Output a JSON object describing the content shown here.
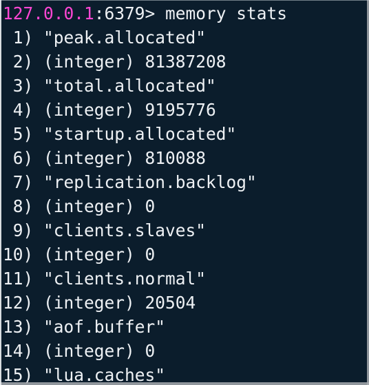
{
  "terminal": {
    "background_color": "#0b1d2c",
    "foreground_color": "#eef1f4",
    "accent_color": "#ff46d4",
    "prompt": {
      "host": "127.0.0.1",
      "port_and_caret": ":6379>",
      "command": " memory stats"
    },
    "output_lines": [
      {
        "index": " 1)",
        "text": " \"peak.allocated\""
      },
      {
        "index": " 2)",
        "text": " (integer) 81387208"
      },
      {
        "index": " 3)",
        "text": " \"total.allocated\""
      },
      {
        "index": " 4)",
        "text": " (integer) 9195776"
      },
      {
        "index": " 5)",
        "text": " \"startup.allocated\""
      },
      {
        "index": " 6)",
        "text": " (integer) 810088"
      },
      {
        "index": " 7)",
        "text": " \"replication.backlog\""
      },
      {
        "index": " 8)",
        "text": " (integer) 0"
      },
      {
        "index": " 9)",
        "text": " \"clients.slaves\""
      },
      {
        "index": "10)",
        "text": " (integer) 0"
      },
      {
        "index": "11)",
        "text": " \"clients.normal\""
      },
      {
        "index": "12)",
        "text": " (integer) 20504"
      },
      {
        "index": "13)",
        "text": " \"aof.buffer\""
      },
      {
        "index": "14)",
        "text": " (integer) 0"
      },
      {
        "index": "15)",
        "text": " \"lua.caches\""
      }
    ]
  }
}
